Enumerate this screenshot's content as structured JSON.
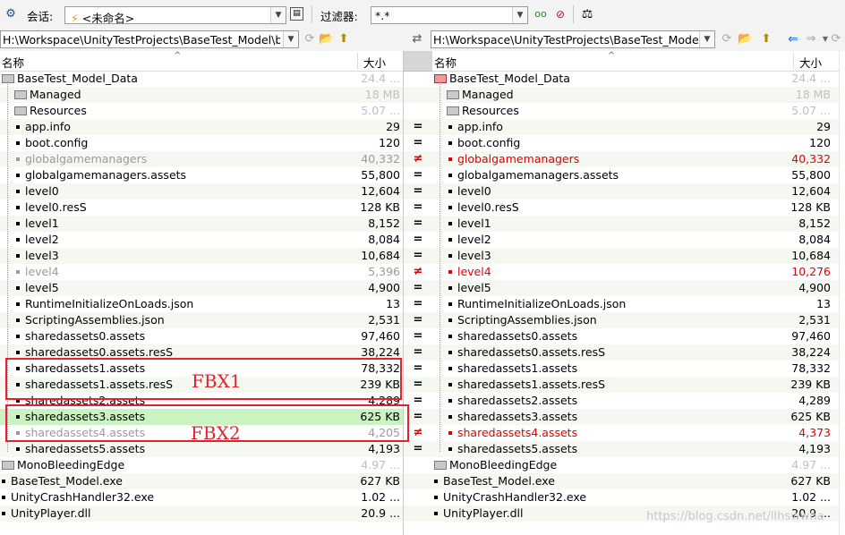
{
  "toolbar": {
    "session_label": "会话:",
    "session_value": "<未命名>",
    "filter_label": "过滤器:",
    "filter_value": "*.*"
  },
  "paths": {
    "left": "H:\\Workspace\\UnityTestProjects\\BaseTest_Model\\b",
    "right": "H:\\Workspace\\UnityTestProjects\\BaseTest_Model\\b"
  },
  "columns": {
    "name": "名称",
    "size": "大小"
  },
  "left_rows": [
    {
      "name": "BaseTest_Model_Data",
      "size": "24.4 ...",
      "kind": "root",
      "state": "dim"
    },
    {
      "name": "Managed",
      "size": "18 MB",
      "kind": "folder",
      "state": "dim"
    },
    {
      "name": "Resources",
      "size": "5.07 ...",
      "kind": "folder",
      "state": "dim"
    },
    {
      "name": "app.info",
      "size": "29",
      "kind": "file",
      "state": "normal"
    },
    {
      "name": "boot.config",
      "size": "120",
      "kind": "file",
      "state": "normal"
    },
    {
      "name": "globalgamemanagers",
      "size": "40,332",
      "kind": "file",
      "state": "gray"
    },
    {
      "name": "globalgamemanagers.assets",
      "size": "55,800",
      "kind": "file",
      "state": "normal"
    },
    {
      "name": "level0",
      "size": "12,604",
      "kind": "file",
      "state": "normal"
    },
    {
      "name": "level0.resS",
      "size": "128 KB",
      "kind": "file",
      "state": "normal"
    },
    {
      "name": "level1",
      "size": "8,152",
      "kind": "file",
      "state": "normal"
    },
    {
      "name": "level2",
      "size": "8,084",
      "kind": "file",
      "state": "normal"
    },
    {
      "name": "level3",
      "size": "10,684",
      "kind": "file",
      "state": "normal"
    },
    {
      "name": "level4",
      "size": "5,396",
      "kind": "file",
      "state": "gray"
    },
    {
      "name": "level5",
      "size": "4,900",
      "kind": "file",
      "state": "normal"
    },
    {
      "name": "RuntimeInitializeOnLoads.json",
      "size": "13",
      "kind": "file",
      "state": "normal"
    },
    {
      "name": "ScriptingAssemblies.json",
      "size": "2,531",
      "kind": "file",
      "state": "normal"
    },
    {
      "name": "sharedassets0.assets",
      "size": "97,460",
      "kind": "file",
      "state": "normal"
    },
    {
      "name": "sharedassets0.assets.resS",
      "size": "38,224",
      "kind": "file",
      "state": "normal"
    },
    {
      "name": "sharedassets1.assets",
      "size": "78,332",
      "kind": "file",
      "state": "normal"
    },
    {
      "name": "sharedassets1.assets.resS",
      "size": "239 KB",
      "kind": "file",
      "state": "normal"
    },
    {
      "name": "sharedassets2.assets",
      "size": "4,289",
      "kind": "file",
      "state": "normal"
    },
    {
      "name": "sharedassets3.assets",
      "size": "625 KB",
      "kind": "file",
      "state": "hl"
    },
    {
      "name": "sharedassets4.assets",
      "size": "4,205",
      "kind": "file",
      "state": "gray"
    },
    {
      "name": "sharedassets5.assets",
      "size": "4,193",
      "kind": "file",
      "state": "normal"
    },
    {
      "name": "MonoBleedingEdge",
      "size": "4.97 ...",
      "kind": "root",
      "state": "dim"
    },
    {
      "name": "BaseTest_Model.exe",
      "size": "627 KB",
      "kind": "top",
      "state": "normal"
    },
    {
      "name": "UnityCrashHandler32.exe",
      "size": "1.02 ...",
      "kind": "top",
      "state": "normal"
    },
    {
      "name": "UnityPlayer.dll",
      "size": "20.9 ...",
      "kind": "top",
      "state": "normal"
    }
  ],
  "right_rows": [
    {
      "name": "BaseTest_Model_Data",
      "size": "24.4 ...",
      "kind": "rootred",
      "state": "dim"
    },
    {
      "name": "Managed",
      "size": "18 MB",
      "kind": "folder",
      "state": "dim"
    },
    {
      "name": "Resources",
      "size": "5.07 ...",
      "kind": "folder",
      "state": "dim"
    },
    {
      "name": "app.info",
      "size": "29",
      "kind": "file",
      "state": "normal"
    },
    {
      "name": "boot.config",
      "size": "120",
      "kind": "file",
      "state": "normal"
    },
    {
      "name": "globalgamemanagers",
      "size": "40,332",
      "kind": "file",
      "state": "red"
    },
    {
      "name": "globalgamemanagers.assets",
      "size": "55,800",
      "kind": "file",
      "state": "normal"
    },
    {
      "name": "level0",
      "size": "12,604",
      "kind": "file",
      "state": "normal"
    },
    {
      "name": "level0.resS",
      "size": "128 KB",
      "kind": "file",
      "state": "normal"
    },
    {
      "name": "level1",
      "size": "8,152",
      "kind": "file",
      "state": "normal"
    },
    {
      "name": "level2",
      "size": "8,084",
      "kind": "file",
      "state": "normal"
    },
    {
      "name": "level3",
      "size": "10,684",
      "kind": "file",
      "state": "normal"
    },
    {
      "name": "level4",
      "size": "10,276",
      "kind": "file",
      "state": "red"
    },
    {
      "name": "level5",
      "size": "4,900",
      "kind": "file",
      "state": "normal"
    },
    {
      "name": "RuntimeInitializeOnLoads.json",
      "size": "13",
      "kind": "file",
      "state": "normal"
    },
    {
      "name": "ScriptingAssemblies.json",
      "size": "2,531",
      "kind": "file",
      "state": "normal"
    },
    {
      "name": "sharedassets0.assets",
      "size": "97,460",
      "kind": "file",
      "state": "normal"
    },
    {
      "name": "sharedassets0.assets.resS",
      "size": "38,224",
      "kind": "file",
      "state": "normal"
    },
    {
      "name": "sharedassets1.assets",
      "size": "78,332",
      "kind": "file",
      "state": "normal"
    },
    {
      "name": "sharedassets1.assets.resS",
      "size": "239 KB",
      "kind": "file",
      "state": "normal"
    },
    {
      "name": "sharedassets2.assets",
      "size": "4,289",
      "kind": "file",
      "state": "normal"
    },
    {
      "name": "sharedassets3.assets",
      "size": "625 KB",
      "kind": "file",
      "state": "normal"
    },
    {
      "name": "sharedassets4.assets",
      "size": "4,373",
      "kind": "file",
      "state": "red"
    },
    {
      "name": "sharedassets5.assets",
      "size": "4,193",
      "kind": "file",
      "state": "normal"
    },
    {
      "name": "MonoBleedingEdge",
      "size": "4.97 ...",
      "kind": "root",
      "state": "dim"
    },
    {
      "name": "BaseTest_Model.exe",
      "size": "627 KB",
      "kind": "top",
      "state": "normal"
    },
    {
      "name": "UnityCrashHandler32.exe",
      "size": "1.02 ...",
      "kind": "top",
      "state": "normal"
    },
    {
      "name": "UnityPlayer.dll",
      "size": "20.9 ...",
      "kind": "top",
      "state": "normal"
    }
  ],
  "gutter": [
    "",
    "",
    "",
    "=",
    "=",
    "≠",
    "=",
    "=",
    "=",
    "=",
    "=",
    "=",
    "≠",
    "=",
    "=",
    "=",
    "=",
    "=",
    "=",
    "=",
    "=",
    "=",
    "≠",
    "=",
    "",
    "",
    "",
    ""
  ],
  "annotations": {
    "box1": "FBX1",
    "box2": "FBX2"
  },
  "watermark": "https://blog.csdn.net/llhswwha",
  "colors": {
    "diff_red": "#e00000",
    "highlight_green": "#c9f3c0",
    "annotation_red": "#e0242d"
  },
  "icons": [
    "session-icon",
    "save-icon",
    "glasses-icon",
    "no-diff-icon",
    "balance-icon",
    "swap-icon",
    "browse-icon",
    "open-folder-icon",
    "up-folder-icon",
    "nav-back-icon",
    "nav-forward-icon"
  ]
}
